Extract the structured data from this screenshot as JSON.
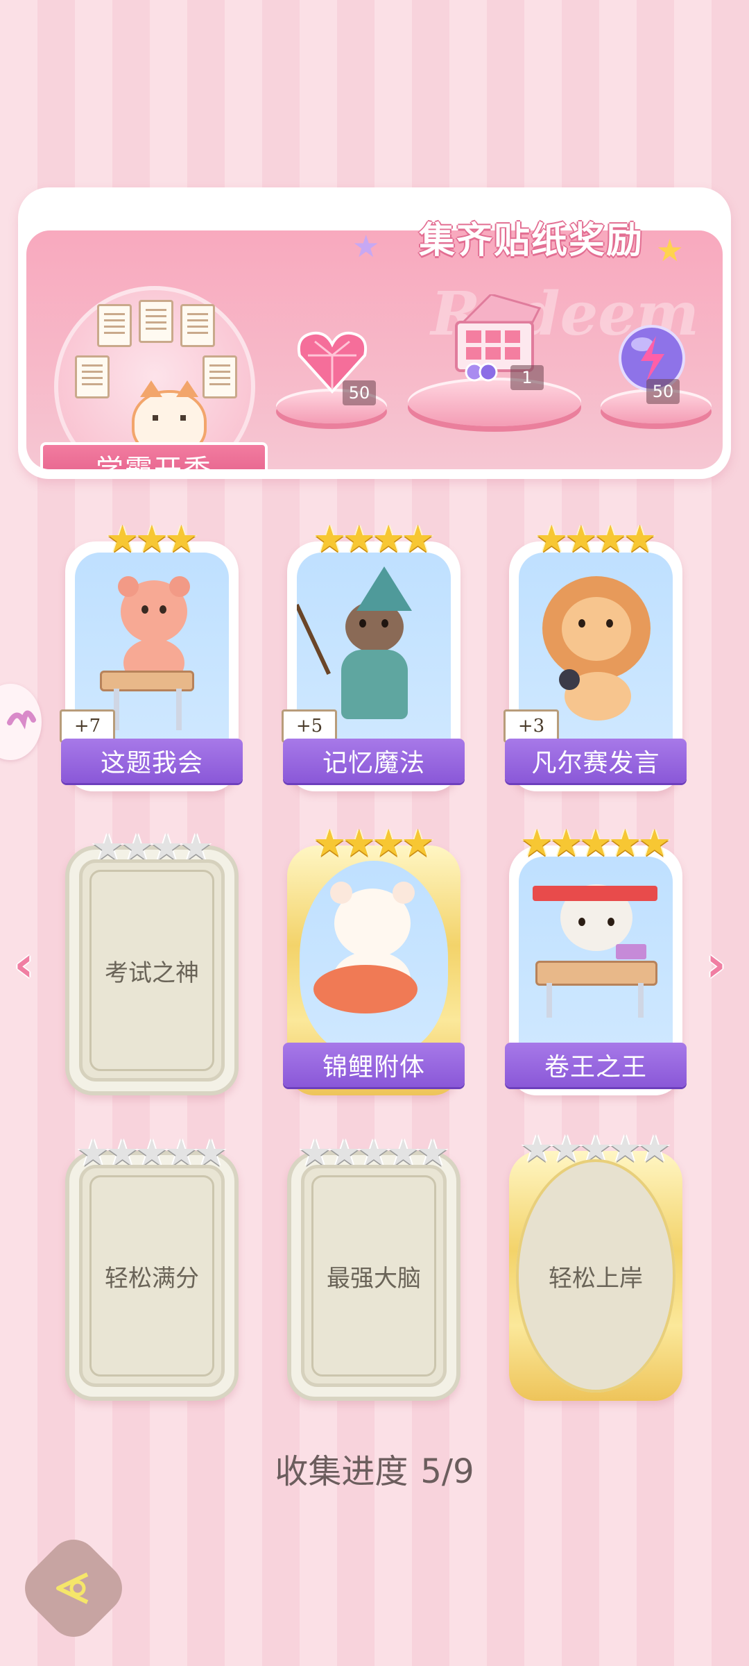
{
  "banner": {
    "title": "集齐贴纸奖励",
    "watermark": "Redeem",
    "theme_name": "学霸开秀",
    "rewards": [
      {
        "icon": "pink-diamond-heart-icon",
        "count": "50"
      },
      {
        "icon": "gift-box-icon",
        "count": "1"
      },
      {
        "icon": "lightning-orb-icon",
        "count": "50"
      }
    ]
  },
  "cards": [
    {
      "name": "这题我会",
      "stars": 3,
      "star_total": 3,
      "plus": "+7",
      "state": "collected",
      "frame": "white"
    },
    {
      "name": "记忆魔法",
      "stars": 4,
      "star_total": 4,
      "plus": "+5",
      "state": "collected",
      "frame": "white"
    },
    {
      "name": "凡尔赛发言",
      "stars": 4,
      "star_total": 4,
      "plus": "+3",
      "state": "collected",
      "frame": "white"
    },
    {
      "name": "考试之神",
      "stars": 0,
      "star_total": 4,
      "plus": "",
      "state": "locked",
      "frame": "plain"
    },
    {
      "name": "锦鲤附体",
      "stars": 4,
      "star_total": 4,
      "plus": "",
      "state": "collected",
      "frame": "gold"
    },
    {
      "name": "卷王之王",
      "stars": 5,
      "star_total": 5,
      "plus": "",
      "state": "collected",
      "frame": "white"
    },
    {
      "name": "轻松满分",
      "stars": 0,
      "star_total": 5,
      "plus": "",
      "state": "locked",
      "frame": "plain"
    },
    {
      "name": "最强大脑",
      "stars": 0,
      "star_total": 5,
      "plus": "",
      "state": "locked",
      "frame": "plain"
    },
    {
      "name": "轻松上岸",
      "stars": 0,
      "star_total": 5,
      "plus": "",
      "state": "locked",
      "frame": "gold"
    }
  ],
  "progress": {
    "label": "收集进度",
    "value": "5/9"
  },
  "colors": {
    "accent": "#f07ea2",
    "ribbon": "#9b6ae0",
    "star_gold": "#f7c733"
  }
}
